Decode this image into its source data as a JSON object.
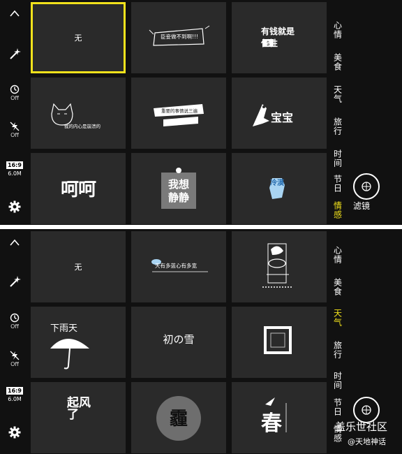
{
  "top": {
    "toolbar": {
      "collapse_icon": "chevron-up-icon",
      "magic_icon": "magic-wand-icon",
      "timer_icon": "timer-icon",
      "timer_label": "Off",
      "flash_icon": "flash-off-icon",
      "flash_label": "Off",
      "ratio_label": "16:9",
      "resolution_label": "6.0M",
      "settings_icon": "gear-icon"
    },
    "stickers": [
      {
        "id": "none",
        "label": "无",
        "selected": true
      },
      {
        "id": "sticker-2",
        "text": "臣妾做不到啊!!!",
        "selected": false
      },
      {
        "id": "sticker-3",
        "text": "有钱就是任性",
        "selected": false
      },
      {
        "id": "sticker-4",
        "text": "我的内心是崩溃的",
        "selected": false
      },
      {
        "id": "sticker-5",
        "text": "重要的事情说三遍",
        "selected": false
      },
      {
        "id": "sticker-6",
        "text": "宝宝",
        "selected": false
      },
      {
        "id": "sticker-7",
        "text": "呵呵",
        "selected": false
      },
      {
        "id": "sticker-8",
        "text": "我想静静",
        "selected": false
      },
      {
        "id": "sticker-9",
        "text": "冷漠",
        "selected": false
      }
    ],
    "categories": [
      {
        "label": "心情",
        "active": false
      },
      {
        "label": "美食",
        "active": false
      },
      {
        "label": "天气",
        "active": false
      },
      {
        "label": "旅行",
        "active": false
      },
      {
        "label": "时间",
        "active": false
      },
      {
        "label": "节日",
        "active": false
      },
      {
        "label": "情感",
        "active": true
      }
    ],
    "filter": {
      "icon": "filter-lens-icon",
      "label": "滤镜"
    }
  },
  "bottom": {
    "toolbar": {
      "collapse_icon": "chevron-up-icon",
      "magic_icon": "magic-wand-icon",
      "timer_icon": "timer-icon",
      "timer_label": "Off",
      "flash_icon": "flash-off-icon",
      "flash_label": "Off",
      "ratio_label": "16:9",
      "resolution_label": "6.0M",
      "settings_icon": "gear-icon"
    },
    "stickers": [
      {
        "id": "none",
        "label": "无",
        "selected": false
      },
      {
        "id": "sticker-2",
        "text": "天有多蓝心有多宽",
        "selected": false
      },
      {
        "id": "sticker-3",
        "text": "",
        "selected": false
      },
      {
        "id": "sticker-4",
        "text": "下雨天",
        "selected": false
      },
      {
        "id": "sticker-5",
        "text": "初の雪",
        "selected": false
      },
      {
        "id": "sticker-6",
        "text": "",
        "selected": false
      },
      {
        "id": "sticker-7",
        "text": "起风了",
        "selected": false
      },
      {
        "id": "sticker-8",
        "text": "霾",
        "selected": false
      },
      {
        "id": "sticker-9",
        "text": "春",
        "selected": false
      }
    ],
    "categories": [
      {
        "label": "心情",
        "active": false
      },
      {
        "label": "美食",
        "active": false
      },
      {
        "label": "天气",
        "active": true
      },
      {
        "label": "旅行",
        "active": false
      },
      {
        "label": "时间",
        "active": false
      },
      {
        "label": "节日",
        "active": false
      },
      {
        "label": "情感",
        "active": false
      }
    ],
    "filter": {
      "icon": "filter-lens-icon",
      "label": ""
    }
  },
  "watermark": {
    "line1": "盖乐世社区",
    "line2": "@天地神话"
  },
  "colors": {
    "accent": "#f2e21c",
    "background": "#111111",
    "tile": "#2a2a2a"
  }
}
